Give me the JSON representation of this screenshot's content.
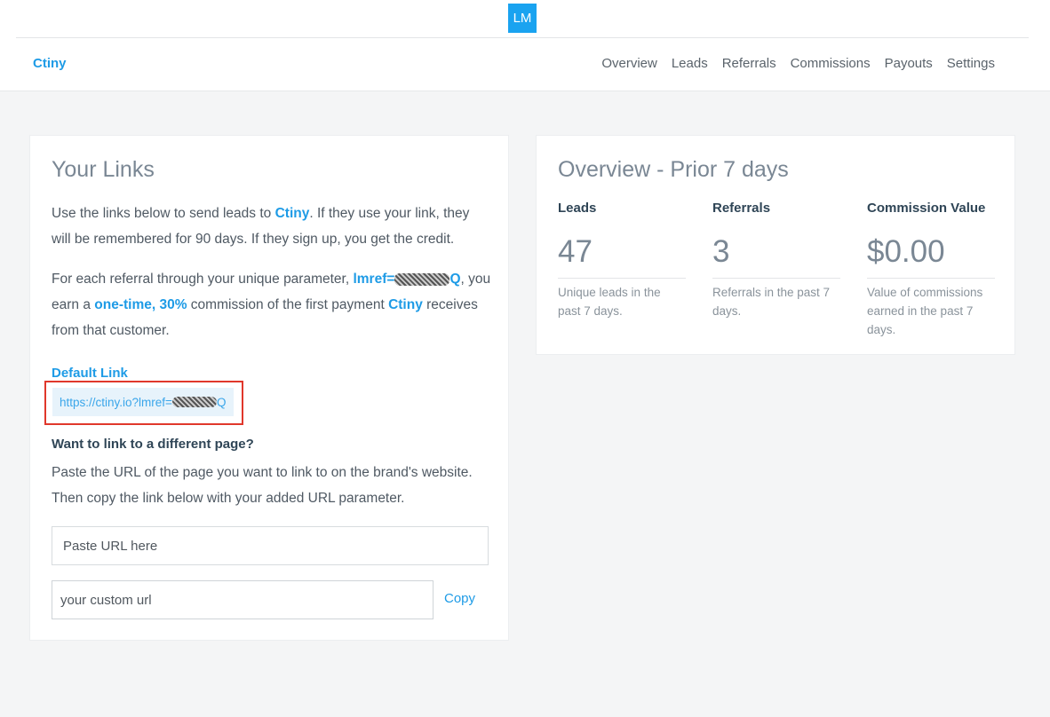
{
  "header": {
    "avatar_initials": "LM",
    "brand": "Ctiny",
    "nav": [
      "Overview",
      "Leads",
      "Referrals",
      "Commissions",
      "Payouts",
      "Settings"
    ]
  },
  "links_card": {
    "title": "Your Links",
    "intro_before": "Use the links below to send leads to ",
    "intro_brand": "Ctiny",
    "intro_after": ". If they use your link, they will be remembered for 90 days. If they sign up, you get the credit.",
    "referral_before": "For each referral through your unique parameter, ",
    "referral_param_prefix": "lmref=",
    "referral_param_suffix": "Q",
    "referral_mid": ", you earn a ",
    "referral_commission": "one-time, 30%",
    "referral_mid2": " commission of the first payment ",
    "referral_brand": "Ctiny",
    "referral_after": " receives from that customer.",
    "default_link_label": "Default Link",
    "default_link_prefix": "https://ctiny.io?lmref=",
    "default_link_suffix": "Q",
    "different_page_heading": "Want to link to a different page?",
    "different_page_text": "Paste the URL of the page you want to link to on the brand's website. Then copy the link below with your added URL parameter.",
    "paste_url_placeholder": "Paste URL here",
    "custom_url_placeholder": "your custom url",
    "copy_label": "Copy"
  },
  "overview_card": {
    "title": "Overview - Prior 7 days",
    "stats": [
      {
        "title": "Leads",
        "value": "47",
        "desc": "Unique leads in the past 7 days."
      },
      {
        "title": "Referrals",
        "value": "3",
        "desc": "Referrals in the past 7 days."
      },
      {
        "title": "Commission Value",
        "value": "$0.00",
        "desc": "Value of commissions earned in the past 7 days."
      }
    ]
  },
  "colors": {
    "accent": "#1e9be6",
    "highlight_border": "#e0372b",
    "avatar_bg": "#1aa3f0"
  }
}
